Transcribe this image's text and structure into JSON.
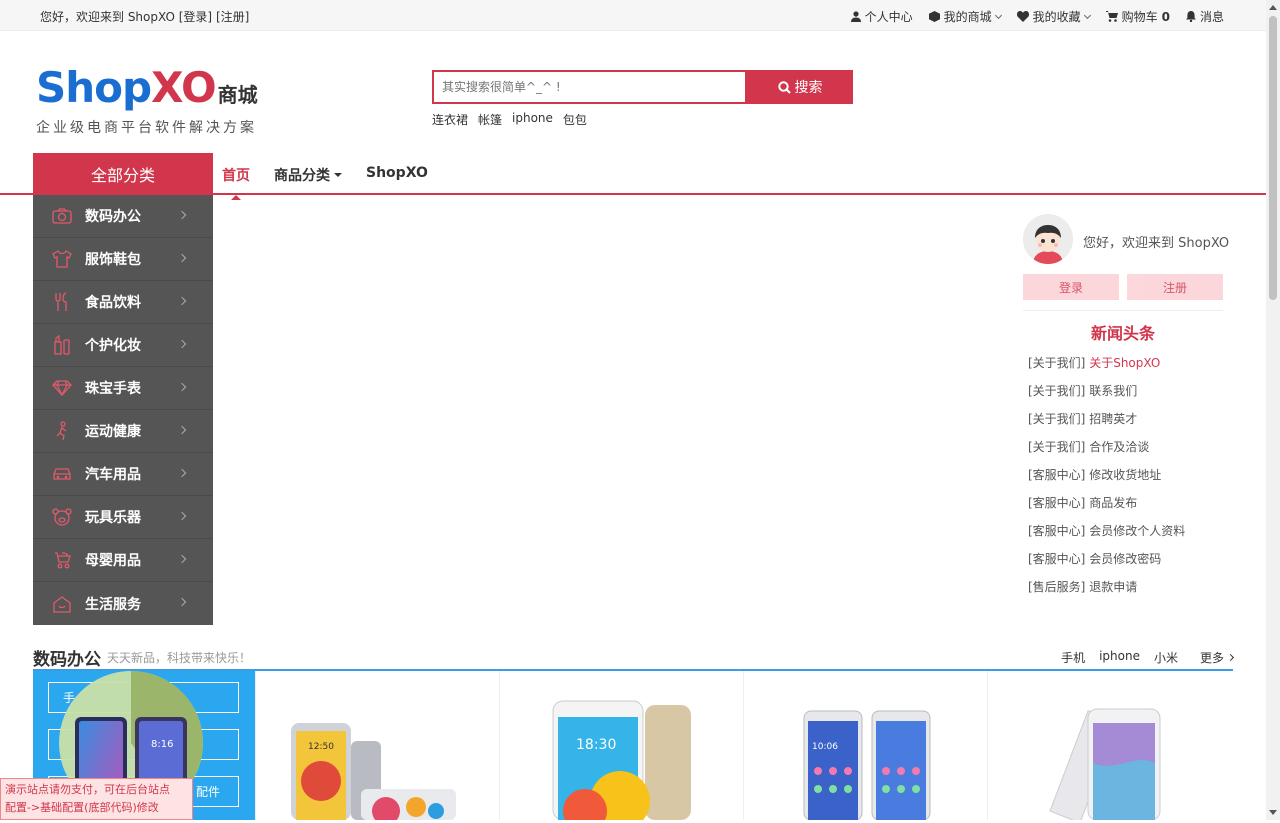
{
  "topbar": {
    "greeting": "您好，欢迎来到 ShopXO",
    "login": "[登录]",
    "register": "[注册]",
    "nav": {
      "user_center": "个人中心",
      "my_mall": "我的商城",
      "favorites": "我的收藏",
      "cart": "购物车",
      "cart_count": "0",
      "messages": "消息"
    }
  },
  "logo": {
    "brand_a": "Shop",
    "brand_b": "XO",
    "brand_c": "商城",
    "tagline": "企业级电商平台软件解决方案"
  },
  "search": {
    "placeholder": "其实搜索很简单^_^ !",
    "button": "搜索",
    "hot": [
      "连衣裙",
      "帐篷",
      "iphone",
      "包包"
    ]
  },
  "navbar": {
    "all_categories": "全部分类",
    "items": [
      "首页",
      "商品分类",
      "ShopXO"
    ]
  },
  "categories": [
    {
      "label": "数码办公",
      "icon": "camera-icon"
    },
    {
      "label": "服饰鞋包",
      "icon": "shirt-icon"
    },
    {
      "label": "食品饮料",
      "icon": "cutlery-icon"
    },
    {
      "label": "个护化妆",
      "icon": "cosmetics-icon"
    },
    {
      "label": "珠宝手表",
      "icon": "diamond-icon"
    },
    {
      "label": "运动健康",
      "icon": "runner-icon"
    },
    {
      "label": "汽车用品",
      "icon": "car-icon"
    },
    {
      "label": "玩具乐器",
      "icon": "toy-icon"
    },
    {
      "label": "母婴用品",
      "icon": "stroller-icon"
    },
    {
      "label": "生活服务",
      "icon": "home-icon"
    }
  ],
  "userbox": {
    "hello": "您好，欢迎来到 ShopXO",
    "login": "登录",
    "register": "注册"
  },
  "news": {
    "title": "新闻头条",
    "items": [
      {
        "cat": "[关于我们]",
        "title": "关于ShopXO"
      },
      {
        "cat": "[关于我们]",
        "title": "联系我们"
      },
      {
        "cat": "[关于我们]",
        "title": "招聘英才"
      },
      {
        "cat": "[关于我们]",
        "title": "合作及洽谈"
      },
      {
        "cat": "[客服中心]",
        "title": "修改收货地址"
      },
      {
        "cat": "[客服中心]",
        "title": "商品发布"
      },
      {
        "cat": "[客服中心]",
        "title": "会员修改个人资料"
      },
      {
        "cat": "[客服中心]",
        "title": "会员修改密码"
      },
      {
        "cat": "[售后服务]",
        "title": "退款申请"
      }
    ]
  },
  "section": {
    "title": "数码办公",
    "subtitle": "天天新品，科技带来快乐！",
    "links": [
      "手机",
      "iphone",
      "小米"
    ],
    "more": "更多"
  },
  "promo": {
    "buttons": [
      "手",
      "",
      "配件"
    ],
    "phone_time": "8:16"
  },
  "products": [
    {
      "screen_text": "12:50"
    },
    {
      "screen_text": "18:30"
    },
    {
      "screen_text": "10:06"
    },
    {
      "screen_text": ""
    }
  ],
  "notice": {
    "line1": "演示站点请勿支付，可在后台站点",
    "line2": "配置->基础配置(底部代码)修改"
  }
}
